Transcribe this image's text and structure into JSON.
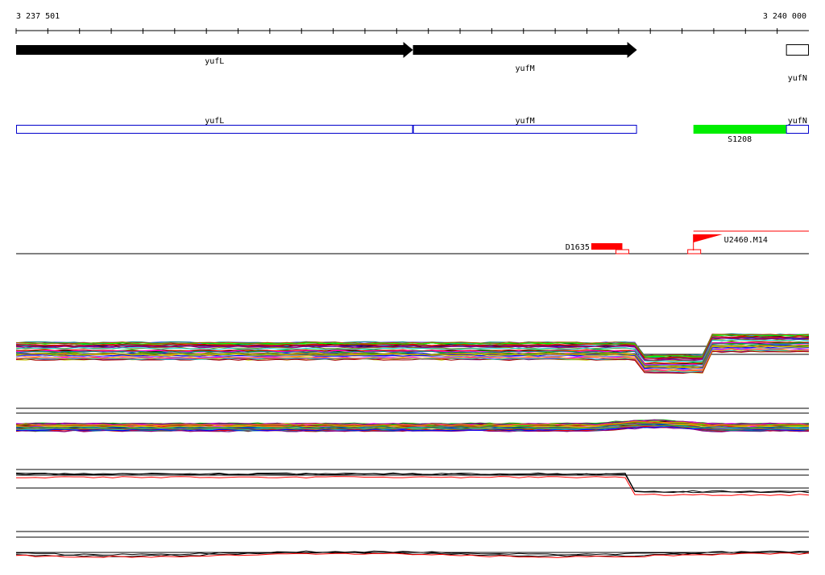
{
  "ruler": {
    "start_label": "3 237 501",
    "end_label": "3 240 000"
  },
  "genes": [
    {
      "name": "yufL",
      "start": 3237501,
      "end": 3238752,
      "strand": "+",
      "filled": true
    },
    {
      "name": "yufM",
      "start": 3238752,
      "end": 3239458,
      "strand": "+",
      "filled": true
    },
    {
      "name": "yufN",
      "start": 3239928,
      "end": 3240000,
      "strand": "+",
      "filled": false
    }
  ],
  "transcript_track": {
    "features": [
      {
        "name": "yufL",
        "start": 3237501,
        "end": 3238752
      },
      {
        "name": "yufM",
        "start": 3238752,
        "end": 3239458
      },
      {
        "name": "yufN",
        "start": 3239928,
        "end": 3240000
      }
    ],
    "segment": {
      "name": "S1208",
      "start": 3239636,
      "end": 3239928
    }
  },
  "upshifts": [
    {
      "name": "D1635",
      "start": 3239314,
      "end": 3239412,
      "kind": "downshift"
    },
    {
      "name": "U2460.M14",
      "start": 3239636,
      "end": 3240000,
      "kind": "upshift"
    }
  ],
  "colors": {
    "gene_fill": "#000000",
    "transcript_outline": "#0000cc",
    "segment": "#00ee00",
    "shift": "#ff0000",
    "axis": "#000000"
  }
}
